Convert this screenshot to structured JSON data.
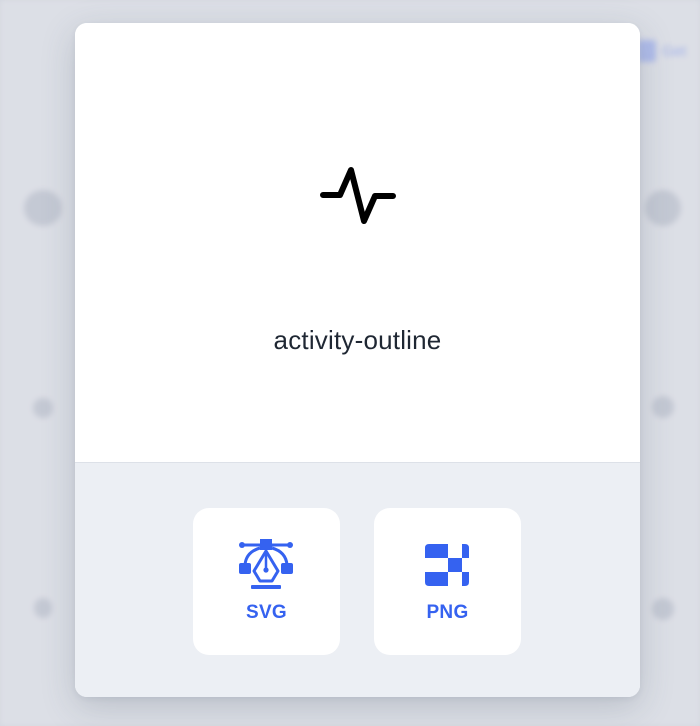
{
  "background": {
    "corner_link_label": "Get"
  },
  "modal": {
    "icon_name": "activity-outline",
    "icon_semantic": "activity-icon",
    "downloads": {
      "svg": {
        "label": "SVG",
        "icon": "vector-pen-icon"
      },
      "png": {
        "label": "PNG",
        "icon": "checkerboard-icon"
      }
    }
  },
  "colors": {
    "accent": "#3562f0",
    "download_area": "#eceff4",
    "text": "#1f2733"
  }
}
